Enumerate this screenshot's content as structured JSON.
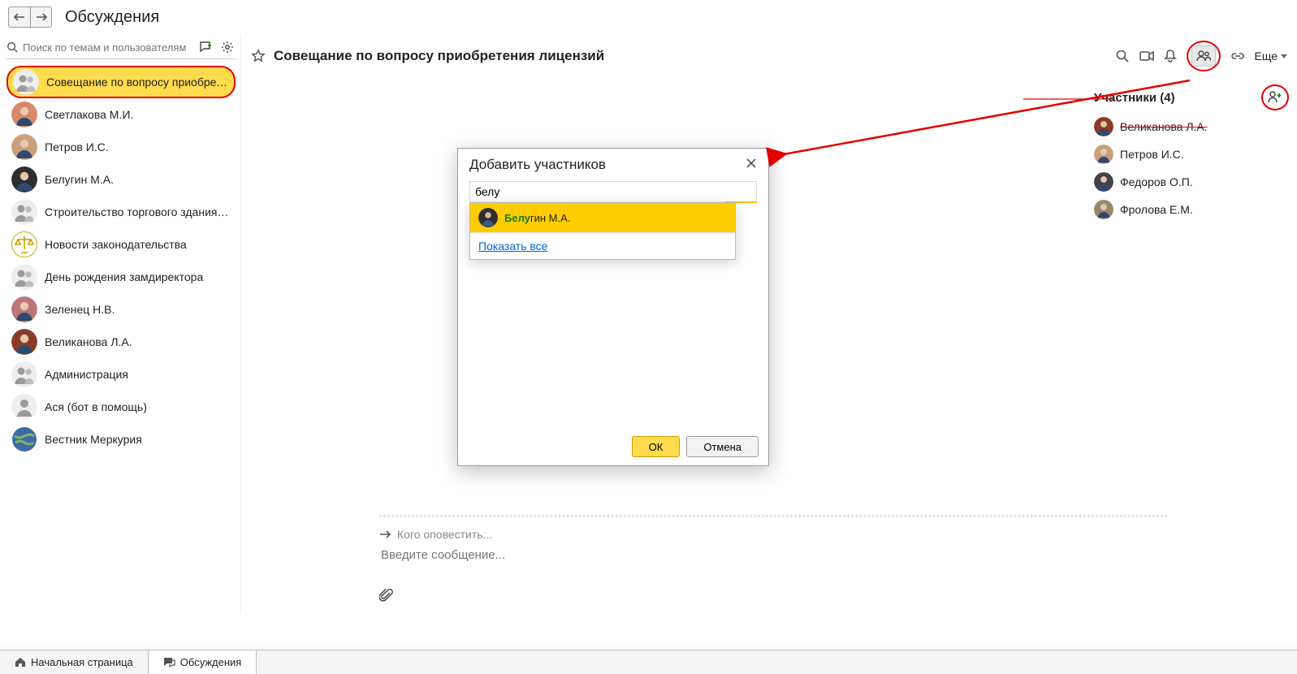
{
  "page": {
    "title": "Обсуждения"
  },
  "sidebar": {
    "search_placeholder": "Поиск по темам и пользователям",
    "items": [
      {
        "label": "Совещание по вопросу приобретения л...",
        "avatar": "group",
        "selected": true
      },
      {
        "label": "Светлакова М.И.",
        "avatar": "f1"
      },
      {
        "label": "Петров И.С.",
        "avatar": "m1"
      },
      {
        "label": "Белугин М.А.",
        "avatar": "m2"
      },
      {
        "label": "Строительство торгового здания (проект)",
        "avatar": "group"
      },
      {
        "label": "Новости законодательства",
        "avatar": "scales"
      },
      {
        "label": "День рождения замдиректора",
        "avatar": "group"
      },
      {
        "label": "Зеленец Н.В.",
        "avatar": "f2"
      },
      {
        "label": "Великанова Л.А.",
        "avatar": "f3"
      },
      {
        "label": "Администрация",
        "avatar": "group"
      },
      {
        "label": "Ася (бот в помощь)",
        "avatar": "bot"
      },
      {
        "label": "Вестник Меркурия",
        "avatar": "globe"
      }
    ]
  },
  "conversation": {
    "title": "Совещание по вопросу приобретения лицензий",
    "more_label": "Еще",
    "notify_placeholder": "Кого оповестить...",
    "message_placeholder": "Введите сообщение..."
  },
  "participants": {
    "title": "Участники (4)",
    "items": [
      {
        "label": "Великанова Л.А.",
        "avatar": "f3"
      },
      {
        "label": "Петров И.С.",
        "avatar": "m1"
      },
      {
        "label": "Федоров О.П.",
        "avatar": "m3"
      },
      {
        "label": "Фролова Е.М.",
        "avatar": "f4"
      }
    ]
  },
  "dialog": {
    "title": "Добавить участников",
    "input_value": "белу",
    "suggestion_match": "Белу",
    "suggestion_rest": "гин М.А.",
    "show_all": "Показать все",
    "ok": "ОК",
    "cancel": "Отмена"
  },
  "tabs": {
    "home": "Начальная страница",
    "discussions": "Обсуждения"
  }
}
